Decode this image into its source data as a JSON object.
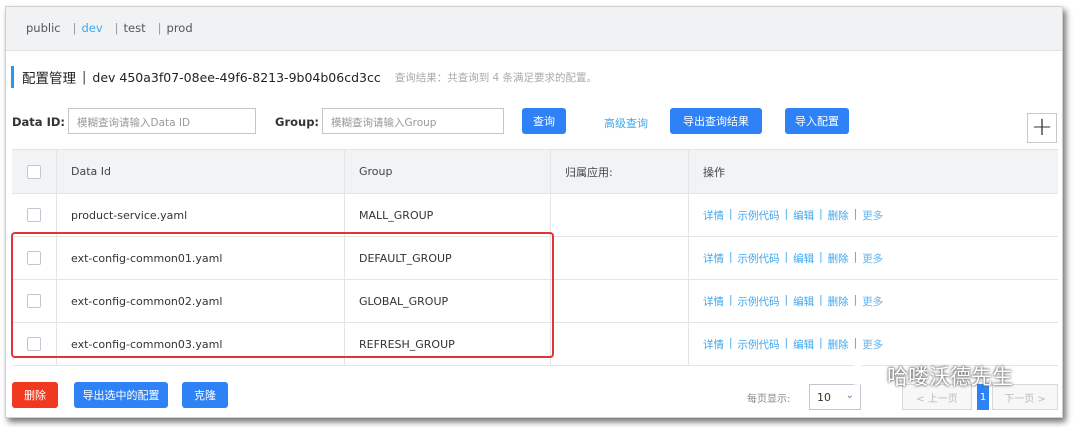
{
  "namespaces": [
    {
      "label": "public",
      "active": false
    },
    {
      "label": "dev",
      "active": true
    },
    {
      "label": "test",
      "active": false
    },
    {
      "label": "prod",
      "active": false
    }
  ],
  "header": {
    "title": "配置管理",
    "separator": "|",
    "namespace": "dev  450a3f07-08ee-49f6-8213-9b04b06cd3cc",
    "result_text": "查询结果：共查询到 4 条满足要求的配置。"
  },
  "search": {
    "data_id_label": "Data ID:",
    "data_id_placeholder": "模糊查询请输入Data ID",
    "group_label": "Group:",
    "group_placeholder": "模糊查询请输入Group",
    "query_button": "查询",
    "advanced_query": "高级查询",
    "export_button": "导出查询结果",
    "import_button": "导入配置",
    "add_button": "+"
  },
  "table": {
    "columns": [
      "Data Id",
      "Group",
      "归属应用:",
      "操作"
    ],
    "rows": [
      {
        "data_id": "product-service.yaml",
        "group": "MALL_GROUP",
        "app": ""
      },
      {
        "data_id": "ext-config-common01.yaml",
        "group": "DEFAULT_GROUP",
        "app": ""
      },
      {
        "data_id": "ext-config-common02.yaml",
        "group": "GLOBAL_GROUP",
        "app": ""
      },
      {
        "data_id": "ext-config-common03.yaml",
        "group": "REFRESH_GROUP",
        "app": ""
      }
    ],
    "actions": {
      "detail": "详情",
      "sample": "示例代码",
      "edit": "编辑",
      "delete": "删除",
      "more": "更多",
      "sep": "|"
    }
  },
  "footer": {
    "delete_button": "删除",
    "export_selected_button": "导出选中的配置",
    "clone_button": "克隆",
    "page_size_label": "每页显示:",
    "page_size_value": "10",
    "prev_label": "< 上一页",
    "current_page": "1",
    "next_label": "下一页 >"
  },
  "watermark": {
    "text": "哈喽沃德先生"
  },
  "colors": {
    "accent": "#2e82f6",
    "link": "#3fa7f0",
    "danger": "#f1391f",
    "highlight": "#e0343a"
  }
}
